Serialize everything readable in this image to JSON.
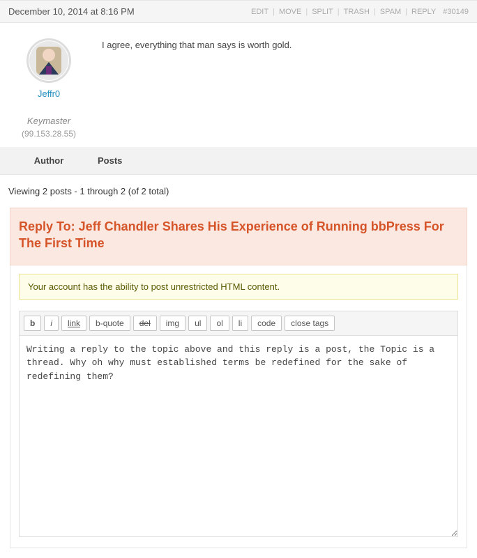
{
  "post": {
    "date": "December 10, 2014 at 8:16 PM",
    "links": {
      "edit": "EDIT",
      "move": "MOVE",
      "split": "SPLIT",
      "trash": "TRASH",
      "spam": "SPAM",
      "reply": "REPLY",
      "id": "#30149"
    },
    "author": {
      "name": "Jeffr0",
      "role": "Keymaster",
      "ip": "(99.153.28.55)"
    },
    "content": "I agree, everything that man says is worth gold."
  },
  "footer": {
    "author_label": "Author",
    "posts_label": "Posts"
  },
  "viewing": "Viewing 2 posts - 1 through 2 (of 2 total)",
  "reply": {
    "title": "Reply To: Jeff Chandler Shares His Experience of Running bbPress For The First Time",
    "notice": "Your account has the ability to post unrestricted HTML content.",
    "quicktags": {
      "b": "b",
      "i": "i",
      "link": "link",
      "bquote": "b-quote",
      "del": "del",
      "img": "img",
      "ul": "ul",
      "ol": "ol",
      "li": "li",
      "code": "code",
      "close": "close tags"
    },
    "textarea_value": "Writing a reply to the topic above and this reply is a post, the Topic is a thread. Why oh why must established terms be redefined for the sake of redefining them?"
  }
}
